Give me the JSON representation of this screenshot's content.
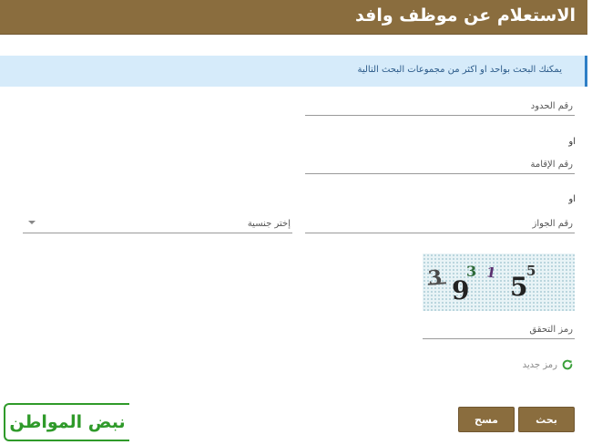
{
  "header": {
    "title": "الاستعلام عن موظف وافد"
  },
  "info": {
    "text": "يمكنك البحث بواحد او اكثر من مجموعات البحث التالية"
  },
  "form": {
    "border_number": {
      "label": "رقم الحدود"
    },
    "or_1": "او",
    "iqama_number": {
      "label": "رقم الإقامة"
    },
    "or_2": "او",
    "passport_number": {
      "label": "رقم الجواز"
    },
    "nationality": {
      "placeholder": "إختر جنسية"
    },
    "captcha": {
      "chars": [
        "3",
        "9",
        "3",
        "1",
        "5",
        "5"
      ],
      "colors": [
        "#4a4a4a",
        "#222222",
        "#2f6a3a",
        "#5a2f6e",
        "#222222",
        "#333333"
      ]
    },
    "captcha_field": {
      "label": "رمز التحقق"
    },
    "refresh": {
      "label": "رمز جديد",
      "icon": "refresh-icon",
      "color": "#3aa03a"
    }
  },
  "buttons": {
    "search": "بحث",
    "clear": "مسح"
  },
  "logo": {
    "text": "نبض المواطن",
    "color": "#2f9a2a"
  },
  "colors": {
    "brand": "#8a6d3e",
    "info_bg": "#d6ebfa",
    "info_accent": "#2f7fc6"
  }
}
